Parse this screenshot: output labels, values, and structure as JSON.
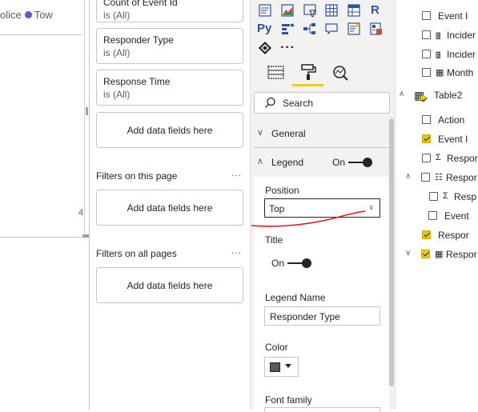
{
  "canvas": {
    "legend_partial": "olice",
    "legend_item": "Tow",
    "legend_item_color": "#744ec2",
    "axis_tick": "4"
  },
  "filters": {
    "cards": [
      {
        "title": "Count of Event Id",
        "value": "is (All)"
      },
      {
        "title": "Responder Type",
        "value": "is (All)"
      },
      {
        "title": "Response Time",
        "value": "is (All)"
      }
    ],
    "add_fields_visual": "Add data fields here",
    "section_page": "Filters on this page",
    "add_fields_page": "Add data fields here",
    "section_all": "Filters on all pages",
    "add_fields_all": "Add data fields here",
    "more": "..."
  },
  "viz": {
    "icons_row1": [
      "table-chart-icon",
      "area-chart-icon",
      "funnel-icon",
      "table-icon",
      "matrix-icon",
      "r-visual-icon"
    ],
    "icons_row2": [
      "python-visual-icon",
      "key-influencers-icon",
      "decomposition-tree-icon",
      "qa-icon",
      "smart-narrative-icon",
      "paginated-report-icon"
    ],
    "icons_row3": [
      "power-apps-icon",
      "more-visuals-icon"
    ],
    "r_label": "R",
    "py_label": "Py",
    "more_label": "···",
    "search_label": "Search",
    "general_label": "General",
    "legend_label": "Legend",
    "legend_toggle": "On",
    "position_label": "Position",
    "position_value": "Top",
    "title_label": "Title",
    "title_toggle": "On",
    "legend_name_label": "Legend Name",
    "legend_name_value": "Responder Type",
    "color_label": "Color",
    "color_value": "#595959",
    "font_family_label": "Font family",
    "accent": "#f2c811",
    "annotation_color": "#e81123"
  },
  "fields": {
    "items": [
      {
        "label": "Event I",
        "checked": false,
        "icon": "",
        "indent": 2
      },
      {
        "label": "Incider",
        "checked": false,
        "icon": "calculator-icon",
        "indent": 2
      },
      {
        "label": "Incider",
        "checked": false,
        "icon": "calculator-icon",
        "indent": 2
      },
      {
        "label": "Month",
        "checked": false,
        "icon": "calendar-table-icon",
        "indent": 2
      },
      {
        "label": "Table2",
        "checked": true,
        "icon": "table-icon",
        "indent": 0
      },
      {
        "label": "Action",
        "checked": false,
        "icon": "",
        "indent": 2
      },
      {
        "label": "Event I",
        "checked": true,
        "icon": "",
        "indent": 2
      },
      {
        "label": "Respor",
        "checked": false,
        "icon": "sigma-icon",
        "indent": 2
      },
      {
        "label": "Respor",
        "checked": false,
        "icon": "hierarchy-icon",
        "indent": 1
      },
      {
        "label": "Resp",
        "checked": false,
        "icon": "sigma-icon",
        "indent": 3
      },
      {
        "label": "Event",
        "checked": false,
        "icon": "",
        "indent": 3
      },
      {
        "label": "Respor",
        "checked": true,
        "icon": "",
        "indent": 2
      },
      {
        "label": "Respor",
        "checked": true,
        "icon": "calendar-table-icon",
        "indent": 1
      }
    ]
  }
}
